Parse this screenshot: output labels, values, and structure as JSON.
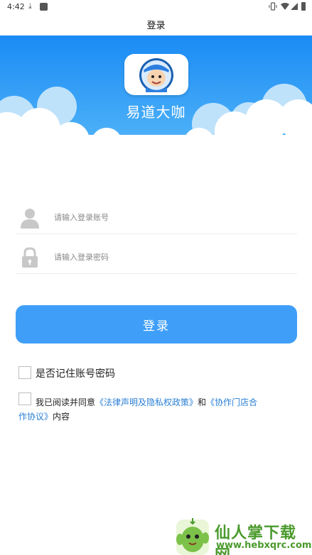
{
  "status_bar": {
    "time": "4:42",
    "download_icon": "download-icon",
    "icons": [
      "vibrate-icon",
      "wifi-icon",
      "signal-icon",
      "battery-icon"
    ]
  },
  "header": {
    "title": "登录"
  },
  "banner": {
    "brand_name": "易道大咖",
    "colors": {
      "sky_top": "#1e8ef5",
      "sky_bottom": "#44aef7",
      "cloud": "#ffffff"
    }
  },
  "form": {
    "account_placeholder": "请输入登录账号",
    "account_value": "",
    "password_placeholder": "请输入登录密码",
    "password_value": "",
    "login_label": "登录",
    "login_color": "#3f9ff8"
  },
  "options": {
    "remember_label": "是否记住账号密码",
    "remember_checked": false,
    "agree_checked": false,
    "agree_prefix": "我已阅读并同意",
    "agree_link1": "《法律声明及隐私权政策》",
    "agree_and": "和",
    "agree_link2_part1": "《协作门店合",
    "agree_link2_part2": "作协议》",
    "agree_suffix": "内容"
  },
  "watermark": {
    "text": "仙人掌下载网",
    "url": "www.hebxqrc.com"
  }
}
